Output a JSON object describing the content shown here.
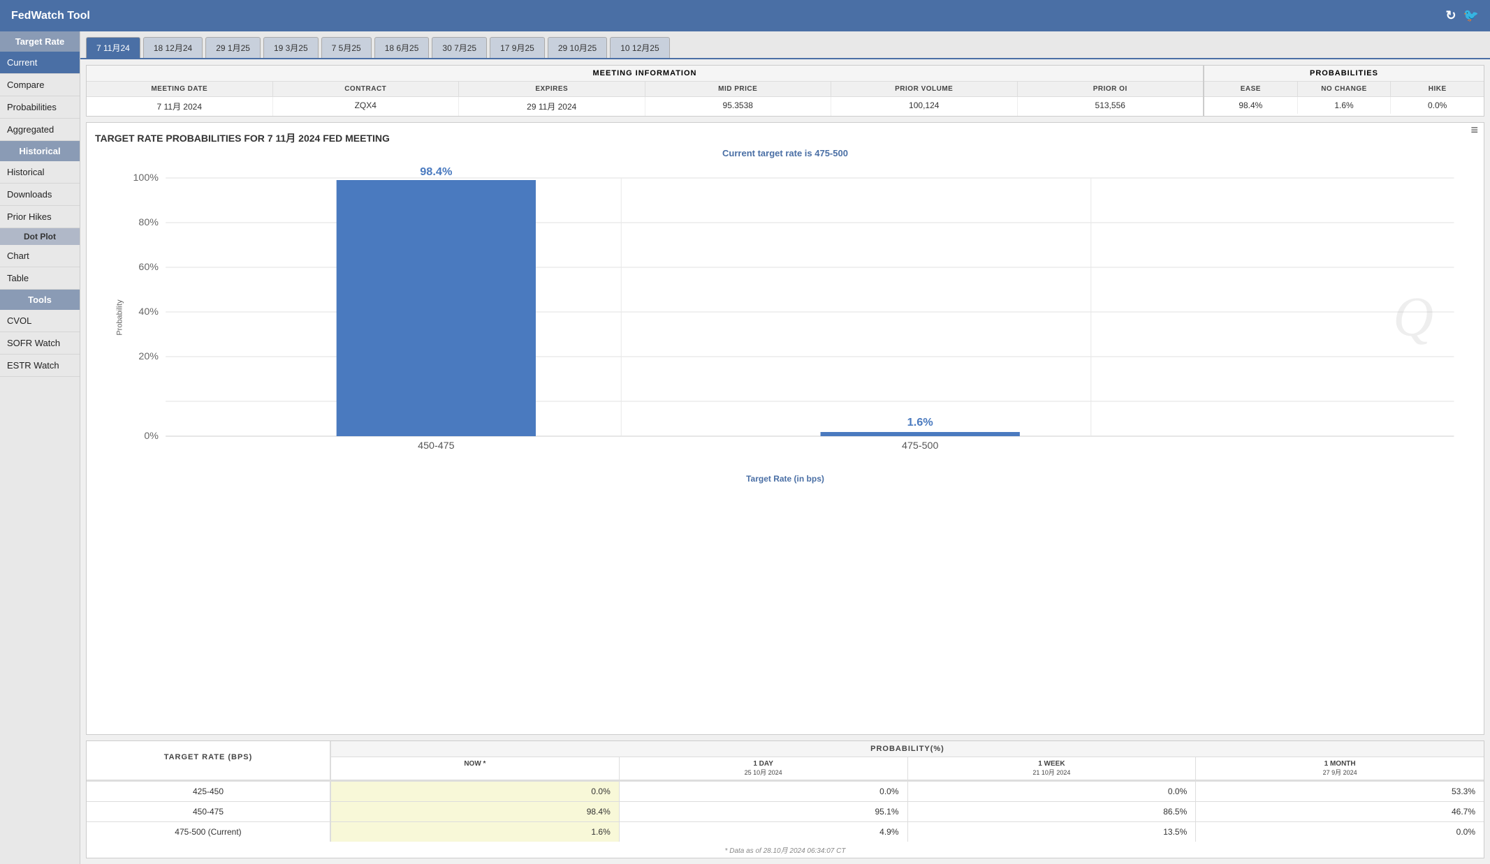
{
  "app": {
    "title": "FedWatch Tool"
  },
  "header": {
    "refresh_icon": "↻",
    "twitter_icon": "🐦"
  },
  "tabs": [
    {
      "label": "7 11月24",
      "active": true
    },
    {
      "label": "18 12月24"
    },
    {
      "label": "29 1月25"
    },
    {
      "label": "19 3月25"
    },
    {
      "label": "7 5月25"
    },
    {
      "label": "18 6月25"
    },
    {
      "label": "30 7月25"
    },
    {
      "label": "17 9月25"
    },
    {
      "label": "29 10月25"
    },
    {
      "label": "10 12月25"
    }
  ],
  "sidebar": {
    "target_rate_label": "Target Rate",
    "current_label": "Current",
    "compare_label": "Compare",
    "probabilities_label": "Probabilities",
    "aggregated_label": "Aggregated",
    "historical_section_label": "Historical",
    "historical_label": "Historical",
    "downloads_label": "Downloads",
    "prior_hikes_label": "Prior Hikes",
    "dot_plot_label": "Dot Plot",
    "chart_label": "Chart",
    "table_label": "Table",
    "tools_label": "Tools",
    "cvol_label": "CVOL",
    "sofr_watch_label": "SOFR Watch",
    "estr_watch_label": "ESTR Watch"
  },
  "meeting_info": {
    "section_title": "MEETING INFORMATION",
    "columns": [
      "MEETING DATE",
      "CONTRACT",
      "EXPIRES",
      "MID PRICE",
      "PRIOR VOLUME",
      "PRIOR OI"
    ],
    "row": {
      "meeting_date": "7 11月 2024",
      "contract": "ZQX4",
      "expires": "29 11月 2024",
      "mid_price": "95.3538",
      "prior_volume": "100,124",
      "prior_oi": "513,556"
    }
  },
  "probabilities": {
    "section_title": "PROBABILITIES",
    "columns": [
      "EASE",
      "NO CHANGE",
      "HIKE"
    ],
    "row": {
      "ease": "98.4%",
      "no_change": "1.6%",
      "hike": "0.0%"
    }
  },
  "chart": {
    "title": "TARGET RATE PROBABILITIES FOR 7 11月 2024 FED MEETING",
    "subtitle": "Current target rate is 475-500",
    "x_label": "Target Rate (in bps)",
    "y_label": "Probability",
    "menu_icon": "≡",
    "watermark": "Q",
    "bars": [
      {
        "label": "450-475",
        "value": 98.4,
        "color": "#4a7abf"
      },
      {
        "label": "475-500",
        "value": 1.6,
        "color": "#4a7abf"
      }
    ],
    "y_ticks": [
      "100%",
      "80%",
      "60%",
      "40%",
      "20%",
      "0%"
    ],
    "bar1_label": "98.4%",
    "bar2_label": "1.6%"
  },
  "bottom_table": {
    "left_header": "TARGET RATE (BPS)",
    "right_header": "PROBABILITY(%)",
    "sub_headers": [
      {
        "label": "NOW *",
        "sub": ""
      },
      {
        "label": "1 DAY",
        "sub": "25 10月 2024"
      },
      {
        "label": "1 WEEK",
        "sub": "21 10月 2024"
      },
      {
        "label": "1 MONTH",
        "sub": "27 9月 2024"
      }
    ],
    "rows": [
      {
        "rate": "425-450",
        "now": "0.0%",
        "one_day": "0.0%",
        "one_week": "0.0%",
        "one_month": "53.3%",
        "now_highlight": true
      },
      {
        "rate": "450-475",
        "now": "98.4%",
        "one_day": "95.1%",
        "one_week": "86.5%",
        "one_month": "46.7%",
        "now_highlight": true
      },
      {
        "rate": "475-500 (Current)",
        "now": "1.6%",
        "one_day": "4.9%",
        "one_week": "13.5%",
        "one_month": "0.0%",
        "now_highlight": true
      }
    ],
    "footer": "* Data as of 28.10月 2024 06:34:07 CT"
  }
}
